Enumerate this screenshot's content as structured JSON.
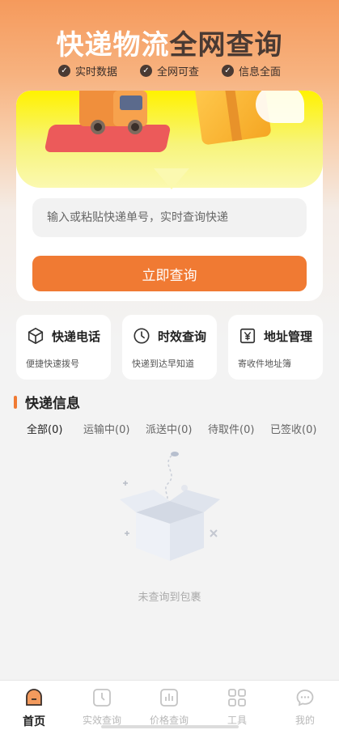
{
  "header": {
    "title_light": "快递物流",
    "title_dark": "全网查询",
    "features": [
      "实时数据",
      "全网可查",
      "信息全面"
    ]
  },
  "search": {
    "placeholder": "输入或粘贴快递单号，实时查询快递",
    "button_label": "立即查询"
  },
  "quick_actions": [
    {
      "title": "快递电话",
      "subtitle": "便捷快速拨号",
      "icon": "box-icon"
    },
    {
      "title": "时效查询",
      "subtitle": "快递到达早知道",
      "icon": "clock-icon"
    },
    {
      "title": "地址管理",
      "subtitle": "寄收件地址簿",
      "icon": "yen-icon"
    }
  ],
  "section": {
    "title": "快递信息"
  },
  "tabs": [
    {
      "label": "全部(0)",
      "active": true
    },
    {
      "label": "运输中(0)",
      "active": false
    },
    {
      "label": "派送中(0)",
      "active": false
    },
    {
      "label": "待取件(0)",
      "active": false
    },
    {
      "label": "已签收(0)",
      "active": false
    }
  ],
  "empty_state": {
    "text": "未查询到包裹"
  },
  "bottom_nav": [
    {
      "label": "首页",
      "icon": "home-icon",
      "active": true
    },
    {
      "label": "实效查询",
      "icon": "clock-icon",
      "active": false
    },
    {
      "label": "价格查询",
      "icon": "chart-icon",
      "active": false
    },
    {
      "label": "工具",
      "icon": "grid-icon",
      "active": false
    },
    {
      "label": "我的",
      "icon": "chat-icon",
      "active": false
    }
  ],
  "colors": {
    "accent": "#f07a33",
    "title_dark": "#4a3a33",
    "banner_yellow": "#fff200"
  }
}
